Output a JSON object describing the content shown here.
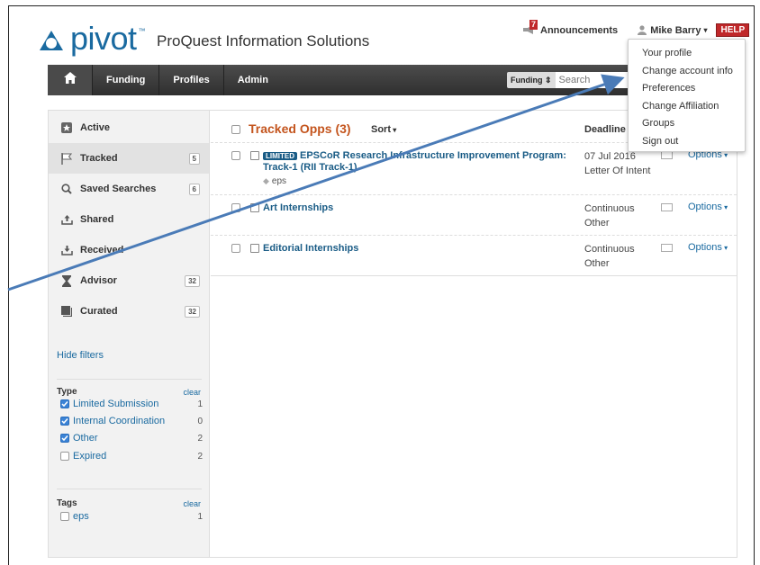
{
  "header": {
    "logo_text": "pivot",
    "logo_tm": "™",
    "company": "ProQuest Information Solutions",
    "announcements_count": "7",
    "announcements_label": "Announcements",
    "user_name": "Mike Barry",
    "help_label": "HELP"
  },
  "nav": {
    "items": [
      "Funding",
      "Profiles",
      "Admin"
    ],
    "search_select": "Funding",
    "search_placeholder": "Search"
  },
  "user_menu": {
    "items": [
      "Your profile",
      "Change account info",
      "Preferences",
      "Change Affiliation",
      "Groups",
      "Sign out"
    ]
  },
  "sidebar": {
    "items": [
      {
        "label": "Active",
        "count": "",
        "icon": "star-box-icon"
      },
      {
        "label": "Tracked",
        "count": "5",
        "icon": "flag-icon"
      },
      {
        "label": "Saved Searches",
        "count": "6",
        "icon": "magnifier-icon"
      },
      {
        "label": "Shared",
        "count": "",
        "icon": "share-tray-icon"
      },
      {
        "label": "Received",
        "count": "",
        "icon": "inbox-tray-icon"
      },
      {
        "label": "Advisor",
        "count": "32",
        "icon": "hourglass-icon"
      },
      {
        "label": "Curated",
        "count": "32",
        "icon": "stack-icon"
      }
    ],
    "hide_filters": "Hide filters",
    "type_filter": {
      "heading": "Type",
      "clear": "clear",
      "options": [
        {
          "label": "Limited Submission",
          "count": "1",
          "checked": true
        },
        {
          "label": "Internal Coordination",
          "count": "0",
          "checked": true
        },
        {
          "label": "Other",
          "count": "2",
          "checked": true
        },
        {
          "label": "Expired",
          "count": "2",
          "checked": false
        }
      ]
    },
    "tags_filter": {
      "heading": "Tags",
      "clear": "clear",
      "options": [
        {
          "label": "eps",
          "count": "1",
          "checked": false
        }
      ]
    }
  },
  "list": {
    "title": "Tracked Opps (3)",
    "sort_label": "Sort",
    "deadline_label": "Deadline",
    "rows": [
      {
        "badge": "LIMITED",
        "title_line1": "EPSCoR Research Infrastructure Improvement Program:",
        "title_line2": "Track-1 (RII Track-1)",
        "tag": "eps",
        "deadline": "07 Jul 2016",
        "deadline_type": "Letter Of Intent",
        "options": "Options"
      },
      {
        "badge": "",
        "title_line1": "Art Internships",
        "deadline": "Continuous",
        "deadline_type": "Other",
        "options": "Options"
      },
      {
        "badge": "",
        "title_line1": "Editorial Internships",
        "deadline": "Continuous",
        "deadline_type": "Other",
        "options": "Options"
      }
    ]
  },
  "colors": {
    "brand": "#1a6aa0",
    "title_orange": "#c4551e",
    "help_red": "#c0282a",
    "arrow_blue": "#4a7bb7"
  }
}
